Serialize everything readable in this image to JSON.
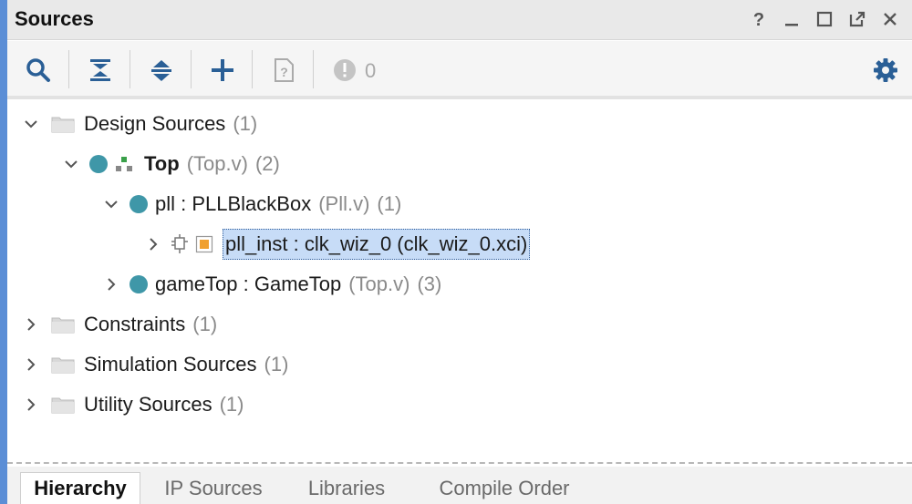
{
  "panel": {
    "title": "Sources"
  },
  "window_controls": [
    "help-icon",
    "minimize-icon",
    "maximize-icon",
    "float-icon",
    "close-icon"
  ],
  "toolbar": {
    "buttons": [
      "search-icon",
      "collapse-all-icon",
      "expand-all-icon",
      "add-icon",
      "properties-icon",
      "status-icon",
      "gear-icon"
    ],
    "message_count": "0"
  },
  "tree": {
    "design_sources": {
      "label": "Design Sources",
      "count": "(1)"
    },
    "top": {
      "name": "Top",
      "file": "(Top.v)",
      "count": "(2)"
    },
    "pll": {
      "name": "pll : PLLBlackBox",
      "file": "(Pll.v)",
      "count": "(1)"
    },
    "pll_inst": {
      "label": "pll_inst : clk_wiz_0 (clk_wiz_0.xci)"
    },
    "game_top": {
      "name": "gameTop : GameTop",
      "file": "(Top.v)",
      "count": "(3)"
    },
    "constraints": {
      "label": "Constraints",
      "count": "(1)"
    },
    "simulation_sources": {
      "label": "Simulation Sources",
      "count": "(1)"
    },
    "utility_sources": {
      "label": "Utility Sources",
      "count": "(1)"
    }
  },
  "tabs": [
    {
      "label": "Hierarchy",
      "active": true
    },
    {
      "label": "IP Sources",
      "active": false
    },
    {
      "label": "Libraries",
      "active": false
    },
    {
      "label": "Compile Order",
      "active": false
    }
  ],
  "colors": {
    "accent": "#5b8ed6",
    "icon_blue": "#2a5f96",
    "source_dot": "#3f97a8",
    "selection": "#c7dcf7",
    "ip_orange": "#f0a030"
  }
}
